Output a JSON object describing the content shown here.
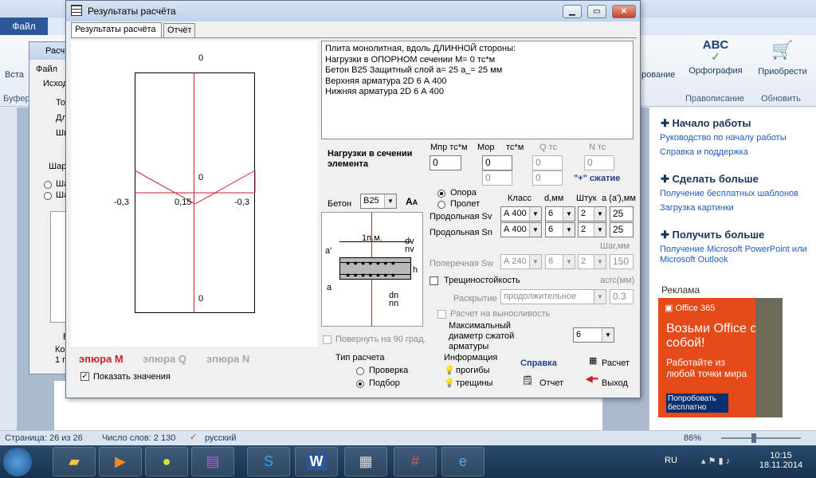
{
  "word": {
    "file_tab": "Файл",
    "ribbon_groups": [
      {
        "label": "Орфография",
        "group": "Правописание"
      },
      {
        "label": "Приобрести",
        "group": "Обновить"
      }
    ],
    "ribbon_partial": "рование",
    "left_partial": [
      "Вста",
      "Буфер"
    ],
    "taskpane": {
      "sections": [
        {
          "title": "Начало работы",
          "links": [
            "Руководство по началу работы",
            "Справка и поддержка"
          ]
        },
        {
          "title": "Сделать больше",
          "links": [
            "Получение бесплатных шаблонов",
            "Загрузка картинки"
          ]
        },
        {
          "title": "Получить больше",
          "links": [
            "Получение Microsoft PowerPoint или Microsoft Outlook"
          ]
        }
      ],
      "ad_header": "Реклама",
      "ad": {
        "brand": "Office 365",
        "headline": "Возьми Office с собой!",
        "body": "Работайте из любой точки мира",
        "button": "Попробовать бесплатно"
      }
    },
    "status": {
      "page": "Страница: 26 из 26",
      "words": "Число слов: 2 130",
      "lang": "русский",
      "zoom": "86%"
    }
  },
  "bg_dialog": {
    "title": "Расч",
    "menu": "Файл",
    "group": "Исход",
    "items": [
      "То",
      "Дл",
      "Ши"
    ],
    "radio_label": "Шар",
    "radio_items": [
      "Ша",
      "Ша"
    ],
    "bottom": [
      "В",
      "Ко",
      "1 п"
    ]
  },
  "dialog": {
    "title": "Результаты расчёта",
    "tabs": [
      "Результаты расчёта",
      "Отчёт"
    ],
    "diagram": {
      "label_top": "0",
      "label_mid": "0",
      "label_bottom": "0",
      "label_left": "-0,3",
      "label_center": "0,15",
      "label_right": "-0,3"
    },
    "diagram_modes": [
      "эпюра М",
      "эпюра Q",
      "эпюра N"
    ],
    "show_values": "Показать значения",
    "report_lines": [
      "Плита монолитная, вдоль ДЛИННОЙ стороны:",
      "Нагрузки в ОПОРНОМ сечении    M= 0 тс*м",
      "Бетон   В25 Защитный слой  а= 25   а_= 25 мм",
      "Верхняя арматура   2D 6 А 400",
      "Нижняя арматура   2D 6 А 400"
    ],
    "loads": {
      "title": "Нагрузки в сечении элемента",
      "mpr_label": "Мпр  тс*м",
      "mop_label": "Мор",
      "mop_unit": "тс*м",
      "q_label": "Q  тс",
      "n_label": "N  тс",
      "mpr": "0",
      "mop1": "0",
      "mop2": "0",
      "q1": "0",
      "q2": "0",
      "n": "0",
      "compression_note": "\"+\" сжатие"
    },
    "concrete": {
      "label": "Бетон",
      "value": "В25"
    },
    "support_radios": [
      "Опора",
      "Пролет"
    ],
    "col_heads": {
      "class": "Класс",
      "d": "d,мм",
      "count": "Штук",
      "a": "a (a'),мм"
    },
    "sv": {
      "label": "Продольная Sv",
      "class": "А 400",
      "d": "6",
      "count": "2",
      "a": "25"
    },
    "sn": {
      "label": "Продольная Sn",
      "class": "А 400",
      "d": "6",
      "count": "2",
      "a": "25"
    },
    "sw": {
      "label": "Поперечная Sw",
      "step_label": "Шаг,мм",
      "class": "А 240",
      "d": "6",
      "count": "2",
      "step": "150"
    },
    "section_fig": {
      "width_label": "1п.м.",
      "dv": "dv",
      "nv": "nv",
      "dn": "dn",
      "nn": "nn",
      "h": "h",
      "a_top": "a'",
      "a_bottom": "a"
    },
    "crack": {
      "label": "Трещиностойкость",
      "acrc_label": "acrc(мм)",
      "opening_label": "Раскрытие",
      "opening_value": "продолжительное",
      "acrc_value": "0.3",
      "fatigue": "Расчет на выносливость"
    },
    "rotate": "Повернуть на 90 град.",
    "maxd": {
      "label": "Максимальный диаметр сжатой арматуры",
      "value": "6"
    },
    "calc_type": {
      "title": "Тип расчета",
      "options": [
        "Проверка",
        "Подбор"
      ]
    },
    "info": {
      "title": "Информация",
      "items": [
        "прогибы",
        "трещины"
      ]
    },
    "actions": {
      "help": "Справка",
      "report": "Отчет",
      "calc": "Расчет",
      "exit": "Выход"
    }
  },
  "taskbar": {
    "lang": "RU",
    "time": "10:15",
    "date": "18.11.2014"
  }
}
